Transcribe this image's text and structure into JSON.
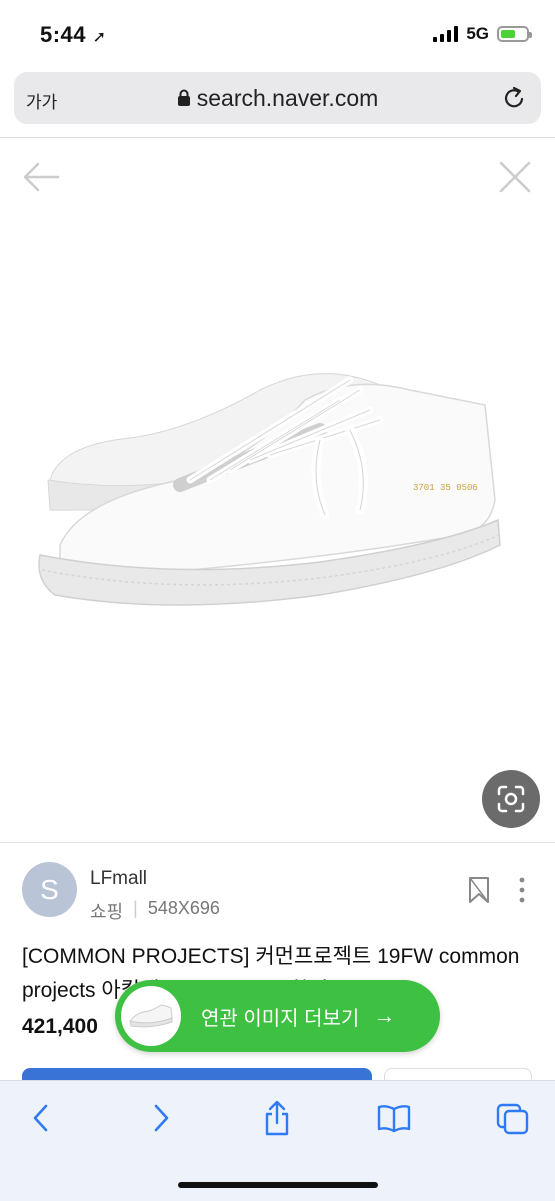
{
  "status_bar": {
    "time": "5:44",
    "network": "5G"
  },
  "url_bar": {
    "text_size_label": "가가",
    "domain": "search.naver.com"
  },
  "source": {
    "avatar_letter": "S",
    "name": "LFmall",
    "category": "쇼핑",
    "dimensions": "548X696"
  },
  "product": {
    "title": "[COMMON PROJECTS] 커먼프로젝트 19FW common projects 아킬레스 3701 0506 화이트 ...",
    "price": "421,400"
  },
  "related_button": {
    "label": "연관 이미지 더보기",
    "arrow": "→"
  },
  "colors": {
    "accent_green": "#3ec042",
    "toolbar_blue": "#2f7bf6"
  }
}
